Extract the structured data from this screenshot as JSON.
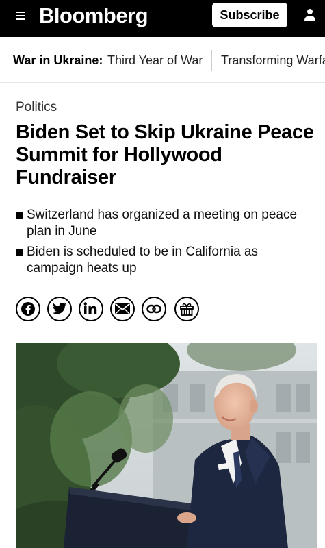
{
  "header": {
    "logo": "Bloomberg",
    "subscribe_label": "Subscribe"
  },
  "nav": {
    "label": "War in Ukraine:",
    "links": [
      "Third Year of War",
      "Transforming Warfa"
    ]
  },
  "article": {
    "category": "Politics",
    "headline": "Biden Set to Skip Ukraine Peace Summit for Hollywood Fundraiser",
    "bullets": [
      "Switzerland has organized a meeting on peace plan in June",
      "Biden is scheduled to be in California as campaign heats up"
    ]
  },
  "share_icons": [
    "facebook-icon",
    "twitter-icon",
    "linkedin-icon",
    "email-icon",
    "link-icon",
    "gift-icon"
  ],
  "colors": {
    "topbar": "#000000",
    "background": "#ffffff",
    "text": "#000000"
  }
}
